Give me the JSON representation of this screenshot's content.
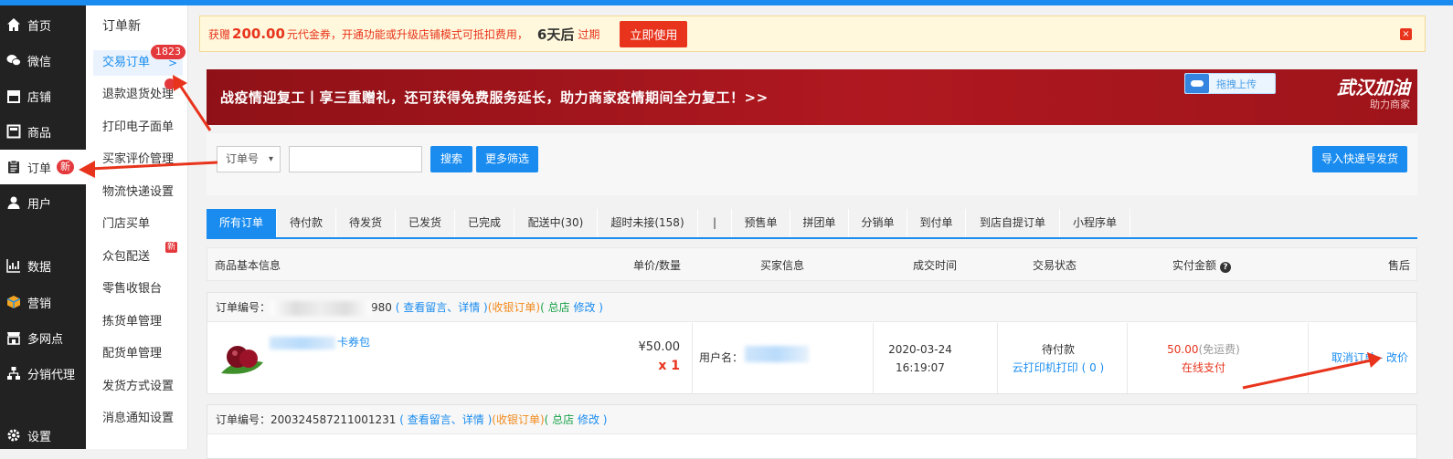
{
  "main_nav": [
    {
      "label": "首页",
      "icon": "home-icon"
    },
    {
      "label": "微信",
      "icon": "wechat-icon"
    },
    {
      "label": "店铺",
      "icon": "store-icon"
    },
    {
      "label": "商品",
      "icon": "product-icon"
    },
    {
      "label": "订单",
      "icon": "clipboard-icon",
      "badge": "新",
      "active": true
    },
    {
      "label": "用户",
      "icon": "user-icon"
    },
    {
      "label": "数据",
      "icon": "chart-icon"
    },
    {
      "label": "营销",
      "icon": "box-icon"
    },
    {
      "label": "多网点",
      "icon": "shop-front-icon"
    },
    {
      "label": "分销代理",
      "icon": "network-icon"
    },
    {
      "label": "设置",
      "icon": "gear-icon"
    }
  ],
  "sub_nav": {
    "title": "订单新",
    "items": [
      {
        "label": "交易订单",
        "active": true
      },
      {
        "label": "退款退货处理"
      },
      {
        "label": "打印电子面单"
      },
      {
        "label": "买家评价管理"
      },
      {
        "label": "物流快递设置"
      },
      {
        "label": "门店买单"
      },
      {
        "label": "众包配送"
      },
      {
        "label": "零售收银台"
      },
      {
        "label": "拣货单管理"
      },
      {
        "label": "配货单管理"
      },
      {
        "label": "发货方式设置"
      },
      {
        "label": "消息通知设置"
      }
    ],
    "trade_count": "1823",
    "new_badge": "新"
  },
  "notice": {
    "prefix": "获赠",
    "amount": "200.00",
    "text": "元代金券，开通功能或升级店铺模式可抵扣费用，",
    "days": "6天后",
    "expire": "过期",
    "button": "立即使用",
    "close": "×"
  },
  "banner": {
    "text": "战疫情迎复工丨享三重赠礼，还可获得免费服务延长，助力商家疫情期间全力复工！>>",
    "upload_label": "拖拽上传",
    "slogan": "武汉加油",
    "slogan_sub": "助力商家"
  },
  "filter": {
    "select_value": "订单号",
    "search_button": "搜索",
    "more_button": "更多筛选",
    "import_button": "导入快递号发货"
  },
  "tabs": [
    "所有订单",
    "待付款",
    "待发货",
    "已发货",
    "已完成",
    "配送中(30)",
    "超时未接(158)",
    "|",
    "预售单",
    "拼团单",
    "分销单",
    "到付单",
    "到店自提订单",
    "小程序单"
  ],
  "table_headers": {
    "product": "商品基本信息",
    "price_qty": "单价/数量",
    "buyer": "买家信息",
    "time": "成交时间",
    "status": "交易状态",
    "amount": "实付金额",
    "after_sale": "售后",
    "help": "?"
  },
  "orders": [
    {
      "order_label": "订单编号：",
      "order_no_suffix": "980",
      "links": "( 查看留言、详情 )",
      "cash_order": "(收银订单)",
      "store": "( 总店",
      "modify": "修改 )",
      "product_name": "卡券包",
      "price": "¥50.00",
      "qty": "x 1",
      "buyer_label": "用户名：",
      "time": "2020-03-24 16:19:07",
      "status": "待付款",
      "print": "云打印机打印 ( 0 )",
      "amount": "50.00",
      "shipping": "(免运费)",
      "pay": "在线支付",
      "after_actions": "取消订单 - 改价"
    },
    {
      "order_label": "订单编号：",
      "order_no": "200324587211001231",
      "links": "( 查看留言、详情 )",
      "cash_order": "(收银订单)",
      "store": "( 总店",
      "modify": "修改 )"
    }
  ]
}
